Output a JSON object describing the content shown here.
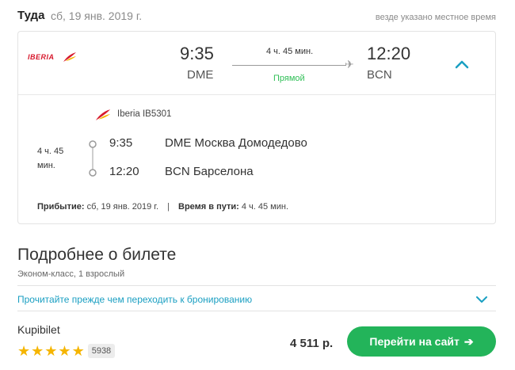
{
  "header": {
    "direction": "Туда",
    "date": "сб, 19 янв. 2019 г.",
    "time_note": "везде указано местное время"
  },
  "flight": {
    "airline_logo_text": "IBERIA",
    "dep_time": "9:35",
    "dep_code": "DME",
    "arr_time": "12:20",
    "arr_code": "BCN",
    "duration": "4 ч. 45 мин.",
    "stops": "Прямой",
    "plane_icon": "✈",
    "expand_icon": "chevron-up-icon"
  },
  "segment": {
    "airline": "Iberia IB5301",
    "duration_line1": "4 ч. 45",
    "duration_line2": "мин.",
    "from_time": "9:35",
    "from_place": "DME Москва Домодедово",
    "to_time": "12:20",
    "to_place": "BCN Барселона"
  },
  "summary": {
    "arrival_label": "Прибытие:",
    "arrival_value": "сб, 19 янв. 2019 г.",
    "separator": "|",
    "travel_label": "Время в пути:",
    "travel_value": "4 ч. 45 мин."
  },
  "ticket": {
    "title": "Подробнее о билете",
    "subtitle": "Эконом-класс, 1 взрослый",
    "read_before": "Прочитайте прежде чем переходить к бронированию"
  },
  "offer": {
    "agent": "Kupibilet",
    "rating_stars": 5,
    "reviews_count": "5938",
    "price": "4 511 р.",
    "button_label": "Перейти на сайт",
    "button_arrow": "➔"
  },
  "colors": {
    "accent_green": "#23b45a",
    "direct_green": "#2fbf56",
    "link_blue": "#1a9fc2",
    "star_yellow": "#f5b500",
    "iberia_red": "#d7192d"
  }
}
